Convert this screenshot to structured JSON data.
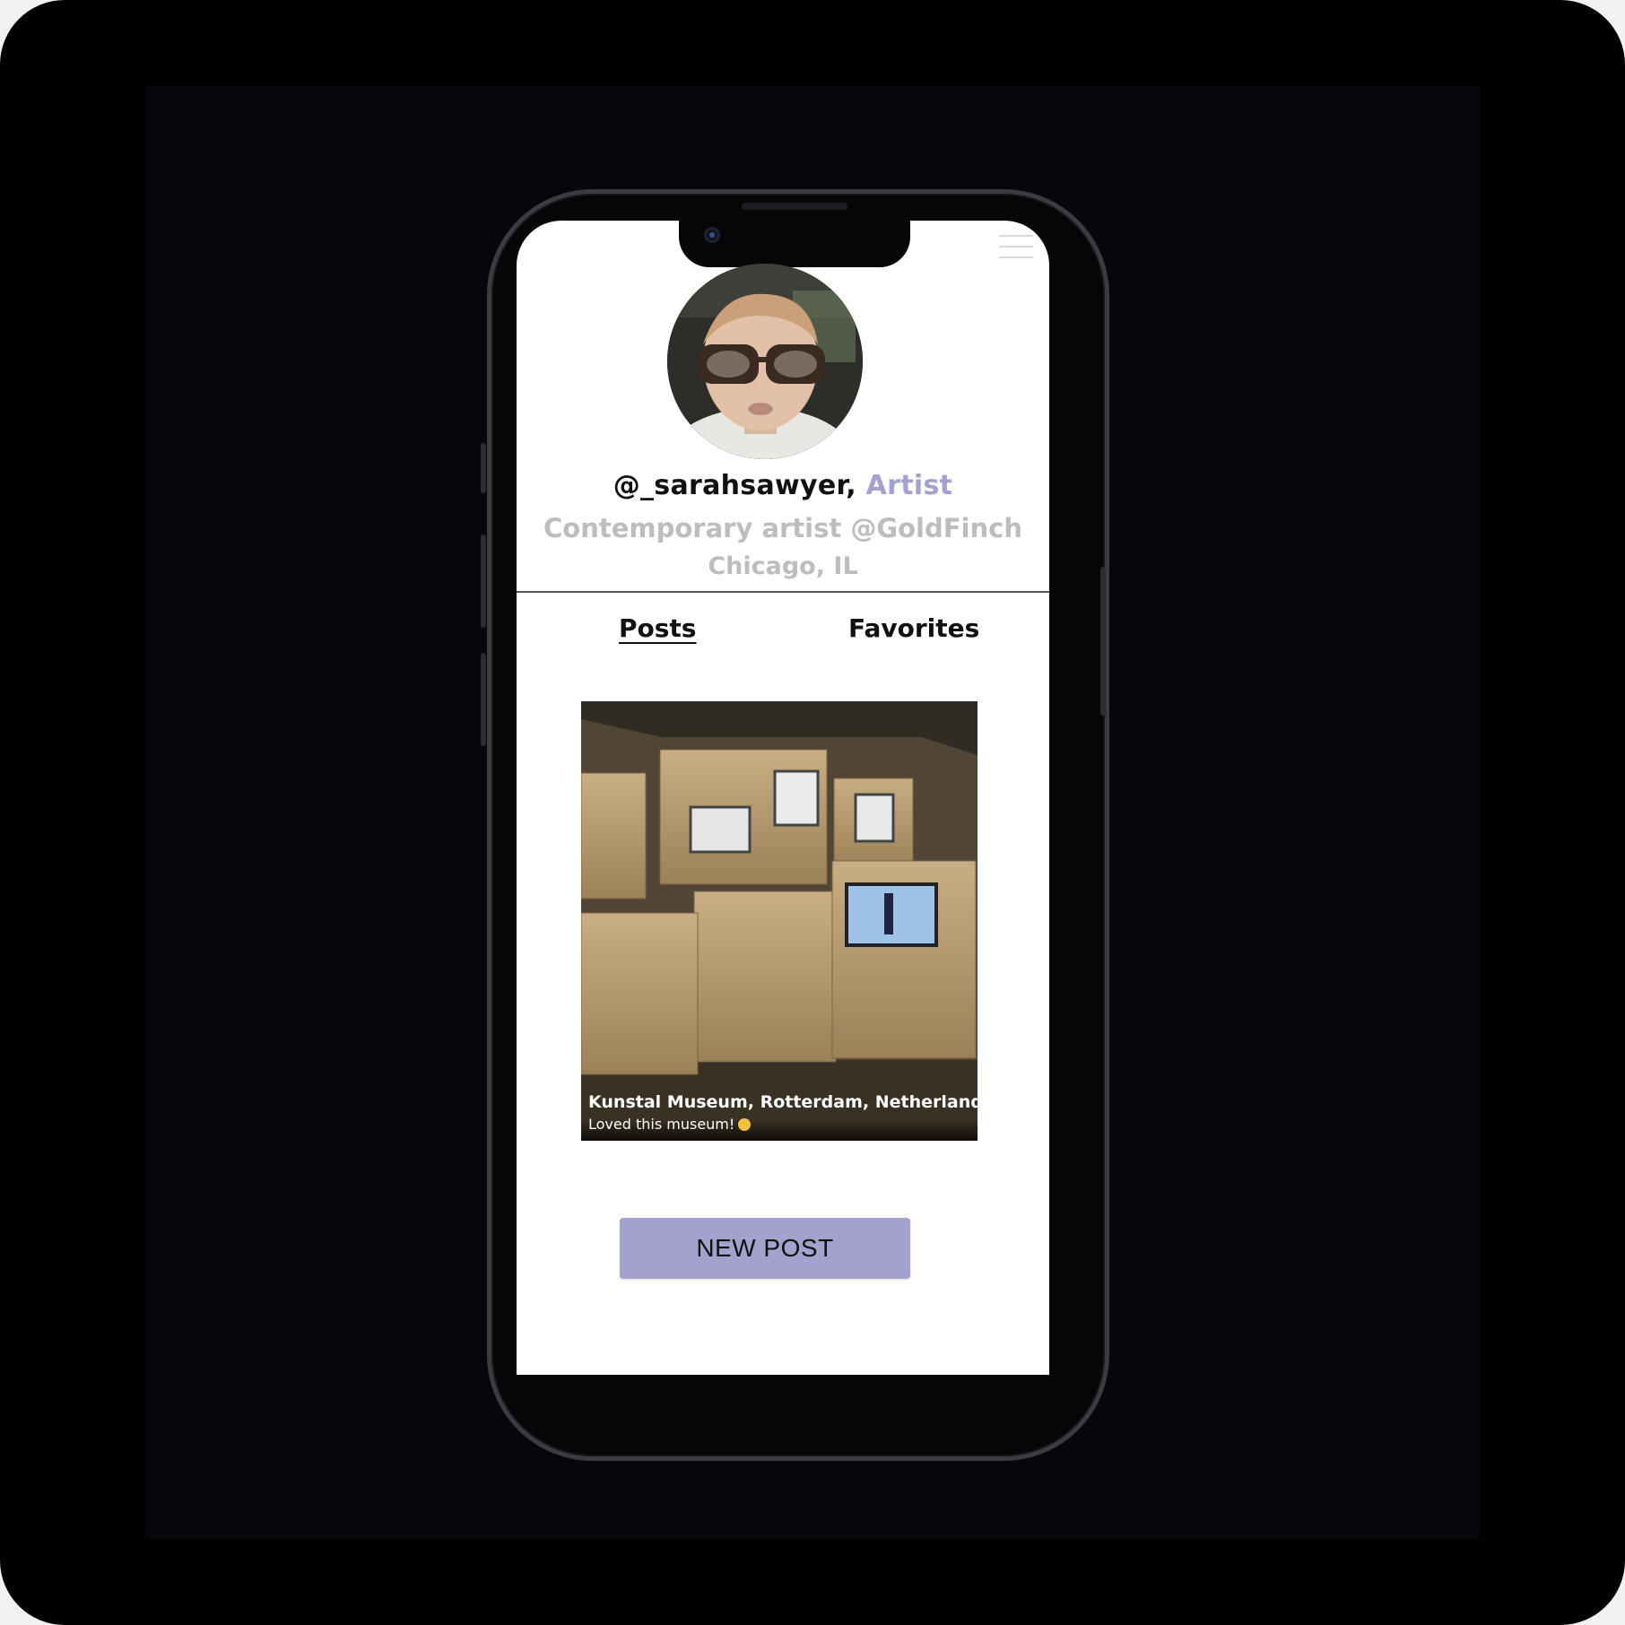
{
  "profile": {
    "handle": "@_sarahsawyer,",
    "role": " Artist",
    "bio": "Contemporary artist @GoldFinch",
    "location": "Chicago, IL"
  },
  "tabs": [
    {
      "label": "Posts",
      "active": true
    },
    {
      "label": "Favorites",
      "active": false
    }
  ],
  "post": {
    "title": "Kunstal Museum, Rotterdam, Netherlands",
    "caption": "Loved this museum!"
  },
  "actions": {
    "new_post_label": "NEW POST"
  },
  "icons": {
    "menu": "hamburger-menu-icon",
    "emoji": "smiling-face-emoji-icon"
  },
  "colors": {
    "accent": "#a3a2cc",
    "muted_text": "#bdbdbd",
    "role_text": "#a3a1cf"
  }
}
